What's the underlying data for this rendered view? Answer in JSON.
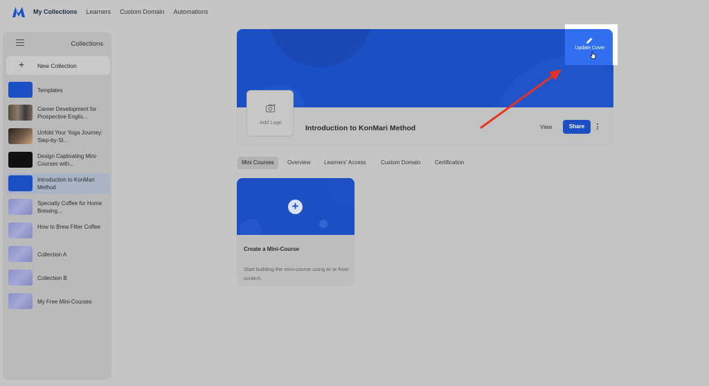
{
  "nav": {
    "links": [
      "My Collections",
      "Learners",
      "Custom Domain",
      "Automations"
    ]
  },
  "sidebar": {
    "title": "Collections",
    "new_collection": "New Collection",
    "items": [
      {
        "label": "Templates"
      },
      {
        "label": "Career Development for Prospective Englis..."
      },
      {
        "label": "Unfold Your Yoga Journey: Step-by-St..."
      },
      {
        "label": "Design Captivating Mini-Courses with..."
      },
      {
        "label": "Introduction to KonMari Method"
      },
      {
        "label": "Specialty Coffee for Home Brewing..."
      },
      {
        "label": "How to Brew Filter Coffee"
      },
      {
        "label": "Collection A"
      },
      {
        "label": "Collection B"
      },
      {
        "label": "My Free Mini-Courses"
      }
    ]
  },
  "cover": {
    "add_logo": "Add Logo",
    "title": "Introduction to KonMari Method",
    "view": "View",
    "share": "Share",
    "update_cover": "Update Cover"
  },
  "tabs": [
    "Mini Courses",
    "Overview",
    "Learners' Access",
    "Custom Domain",
    "Certification"
  ],
  "mini_course": {
    "title": "Create a Mini-Course",
    "desc": "Start building the mini-course using AI or from scratch."
  },
  "colors": {
    "brand_blue": "#1c4fc4",
    "highlight_blue": "#2f6ff0",
    "annotation_arrow": "#e8321f"
  }
}
